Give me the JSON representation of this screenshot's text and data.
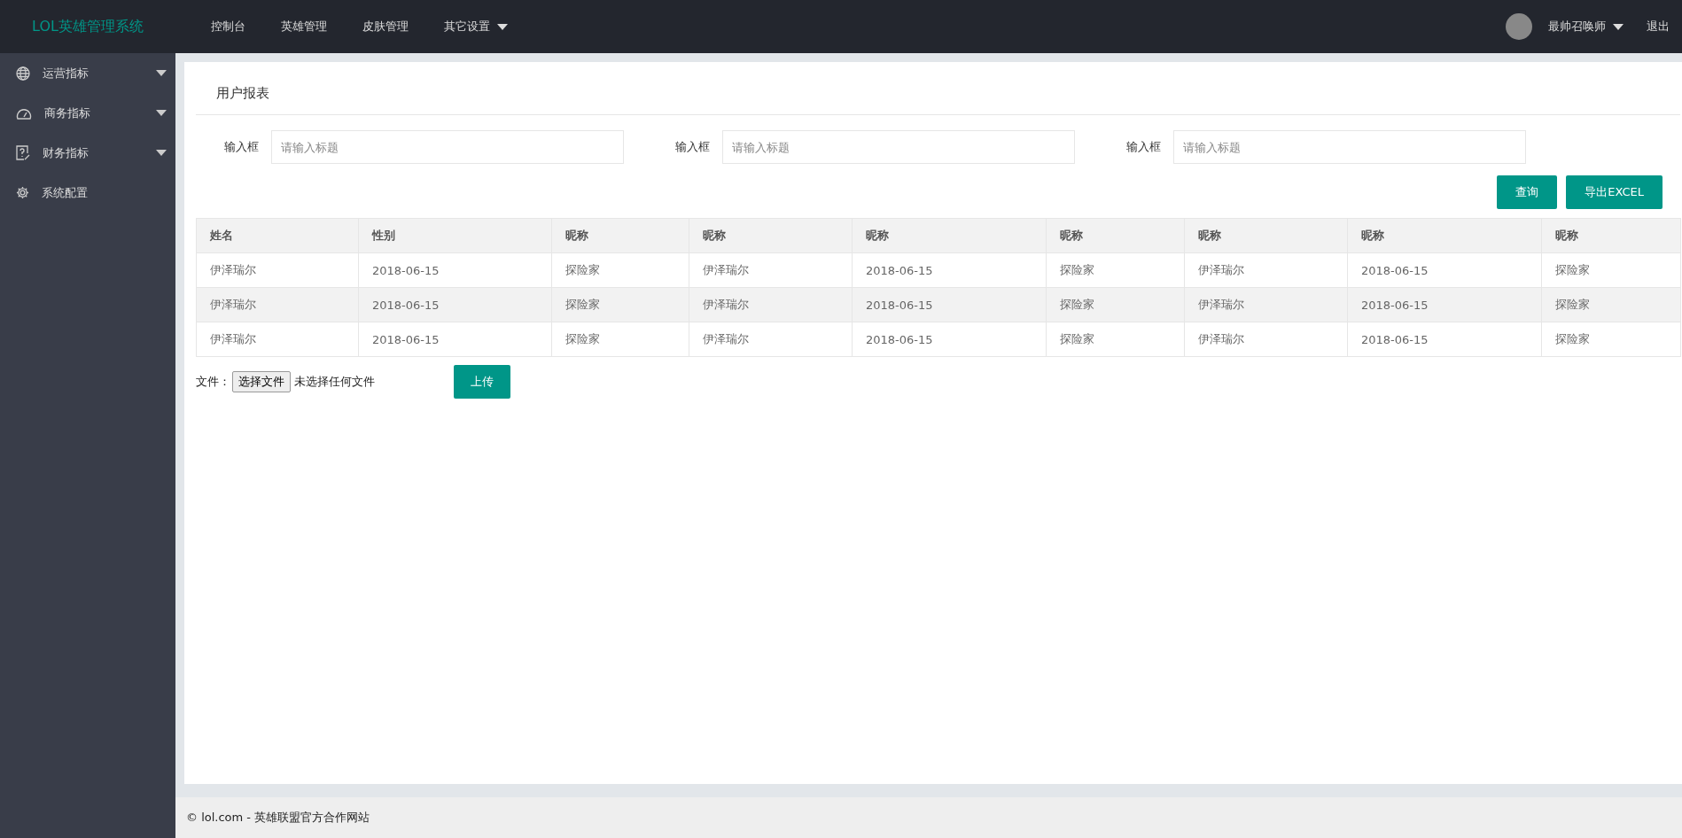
{
  "header": {
    "logo": "LOL英雄管理系统",
    "nav": [
      {
        "label": "控制台",
        "has_menu": false
      },
      {
        "label": "英雄管理",
        "has_menu": false
      },
      {
        "label": "皮肤管理",
        "has_menu": false
      },
      {
        "label": "其它设置",
        "has_menu": true
      }
    ],
    "user": {
      "name": "最帅召唤师"
    },
    "logout": "退出"
  },
  "sidebar": {
    "items": [
      {
        "label": "运营指标",
        "expandable": true
      },
      {
        "label": "商务指标",
        "expandable": true
      },
      {
        "label": "财务指标",
        "expandable": true
      },
      {
        "label": "系统配置",
        "expandable": false
      }
    ]
  },
  "panel": {
    "title": "用户报表",
    "filters": [
      {
        "label": "输入框",
        "placeholder": "请输入标题"
      },
      {
        "label": "输入框",
        "placeholder": "请输入标题"
      },
      {
        "label": "输入框",
        "placeholder": "请输入标题"
      }
    ],
    "buttons": [
      "查询",
      "导出EXCEL"
    ],
    "table": {
      "columns": [
        "姓名",
        "性别",
        "昵称",
        "昵称",
        "昵称",
        "昵称",
        "昵称",
        "昵称",
        "昵称"
      ],
      "rows": [
        [
          "伊泽瑞尔",
          "2018-06-15",
          "探险家",
          "伊泽瑞尔",
          "2018-06-15",
          "探险家",
          "伊泽瑞尔",
          "2018-06-15",
          "探险家"
        ],
        [
          "伊泽瑞尔",
          "2018-06-15",
          "探险家",
          "伊泽瑞尔",
          "2018-06-15",
          "探险家",
          "伊泽瑞尔",
          "2018-06-15",
          "探险家"
        ],
        [
          "伊泽瑞尔",
          "2018-06-15",
          "探险家",
          "伊泽瑞尔",
          "2018-06-15",
          "探险家",
          "伊泽瑞尔",
          "2018-06-15",
          "探险家"
        ]
      ]
    },
    "upload": {
      "label": "文件：",
      "choose_button": "选择文件",
      "file_status": "未选择任何文件",
      "submit": "上传"
    }
  },
  "footer": {
    "text": "© lol.com - 英雄联盟官方合作网站"
  }
}
